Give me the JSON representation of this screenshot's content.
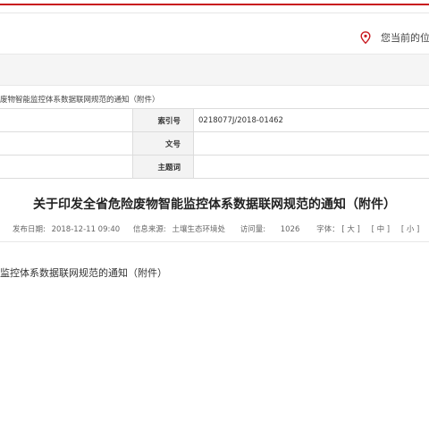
{
  "location": {
    "label": "您当前的位置"
  },
  "breadcrumb": "废物智能监控体系数据联网规范的通知（附件）",
  "meta": {
    "index_label": "索引号",
    "index_value": "0218077J/2018-01462",
    "docno_label": "文号",
    "docno_value": "",
    "subject_label": "主题词",
    "subject_value": ""
  },
  "article": {
    "title": "关于印发全省危险废物智能监控体系数据联网规范的通知（附件）",
    "publish_label": "发布日期:",
    "publish_value": "2018-12-11 09:40",
    "source_label": "信息来源:",
    "source_value": "土壤生态环境处",
    "views_label": "访问量:",
    "views_value": "1026",
    "font_label": "字体：",
    "font_large": "[ 大 ]",
    "font_medium": "[ 中 ]",
    "font_small": "[ 小 ]",
    "body_text": "监控体系数据联网规范的通知（附件）"
  },
  "colors": {
    "accent_red": "#c8161d"
  }
}
